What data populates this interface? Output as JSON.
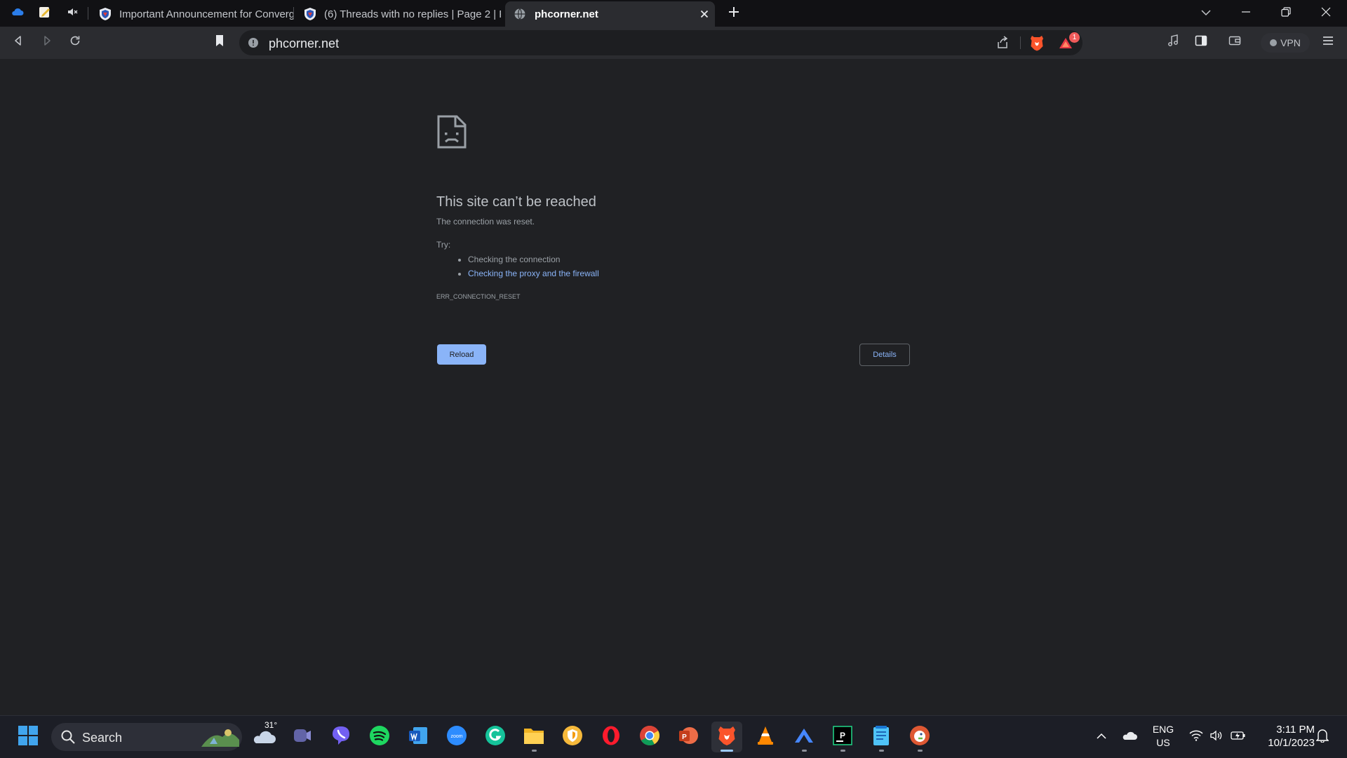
{
  "browser": {
    "tabs": [
      {
        "title": "Important Announcement for Converg",
        "active": false
      },
      {
        "title": "(6) Threads with no replies | Page 2 | P",
        "active": false
      },
      {
        "title": "phcorner.net",
        "active": true
      }
    ],
    "url": "phcorner.net",
    "vpn_label": "VPN",
    "notification_badge": "1"
  },
  "error": {
    "title": "This site can’t be reached",
    "description": "The connection was reset.",
    "try_label": "Try:",
    "suggestions": [
      "Checking the connection",
      "Checking the proxy and the firewall"
    ],
    "code": "ERR_CONNECTION_RESET",
    "reload_label": "Reload",
    "details_label": "Details"
  },
  "taskbar": {
    "search_label": "Search",
    "weather_temp": "31°",
    "language": "ENG",
    "region": "US",
    "time": "3:11 PM",
    "date": "10/1/2023",
    "apps": [
      "widgets",
      "teams",
      "viber",
      "spotify",
      "word",
      "zoom",
      "grammarly",
      "file-explorer",
      "brave-vpn",
      "opera",
      "chrome",
      "powerpoint",
      "brave",
      "vlc",
      "vpn-app",
      "pycharm",
      "notepad",
      "duckduckgo"
    ]
  },
  "colors": {
    "page_background": "#202124",
    "link": "#8ab4f8",
    "tab_strip": "#111114",
    "toolbar": "#2b2c30",
    "brave_orange": "#fb542b"
  }
}
